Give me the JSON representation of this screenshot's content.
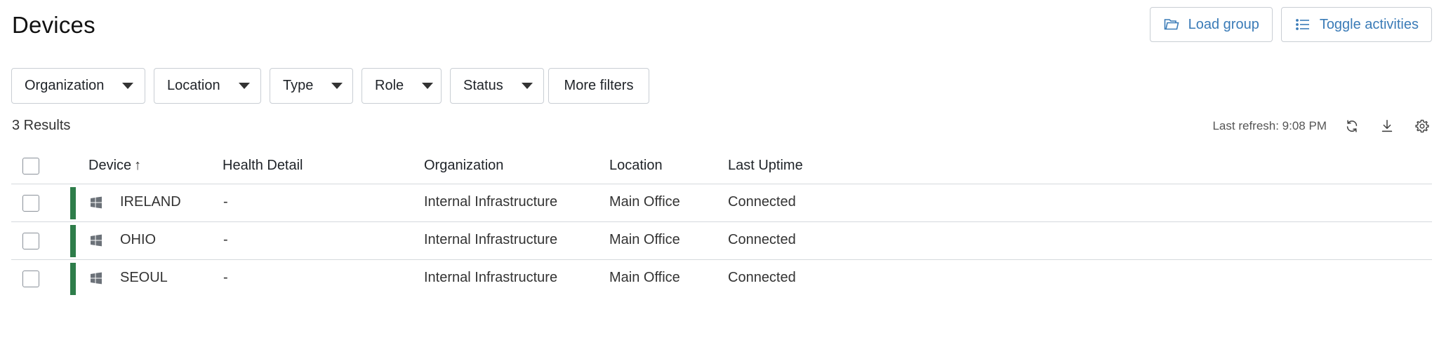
{
  "header": {
    "title": "Devices",
    "load_group_label": "Load group",
    "toggle_activities_label": "Toggle activities"
  },
  "filters": [
    {
      "label": "Organization",
      "dropdown": true
    },
    {
      "label": "Location",
      "dropdown": true
    },
    {
      "label": "Type",
      "dropdown": true
    },
    {
      "label": "Role",
      "dropdown": true
    },
    {
      "label": "Status",
      "dropdown": true
    },
    {
      "label": "More filters",
      "dropdown": false
    }
  ],
  "results": {
    "count_label": "3 Results",
    "last_refresh": "Last refresh: 9:08 PM"
  },
  "table": {
    "columns": [
      "Device",
      "Health Detail",
      "Organization",
      "Location",
      "Last Uptime"
    ],
    "sort_indicator": "↑",
    "rows": [
      {
        "device": "IRELAND",
        "health": "-",
        "organization": "Internal Infrastructure",
        "location": "Main Office",
        "uptime": "Connected"
      },
      {
        "device": "OHIO",
        "health": "-",
        "organization": "Internal Infrastructure",
        "location": "Main Office",
        "uptime": "Connected"
      },
      {
        "device": "SEOUL",
        "health": "-",
        "organization": "Internal Infrastructure",
        "location": "Main Office",
        "uptime": "Connected"
      }
    ]
  },
  "colors": {
    "accent": "#3a7bb7",
    "status_online": "#2e7d4a",
    "border": "#c9ced4"
  },
  "icons": {
    "load_group": "folder-icon",
    "toggle_activities": "list-icon",
    "refresh": "refresh-icon",
    "download": "download-icon",
    "settings": "gear-icon",
    "os": "windows-icon"
  }
}
